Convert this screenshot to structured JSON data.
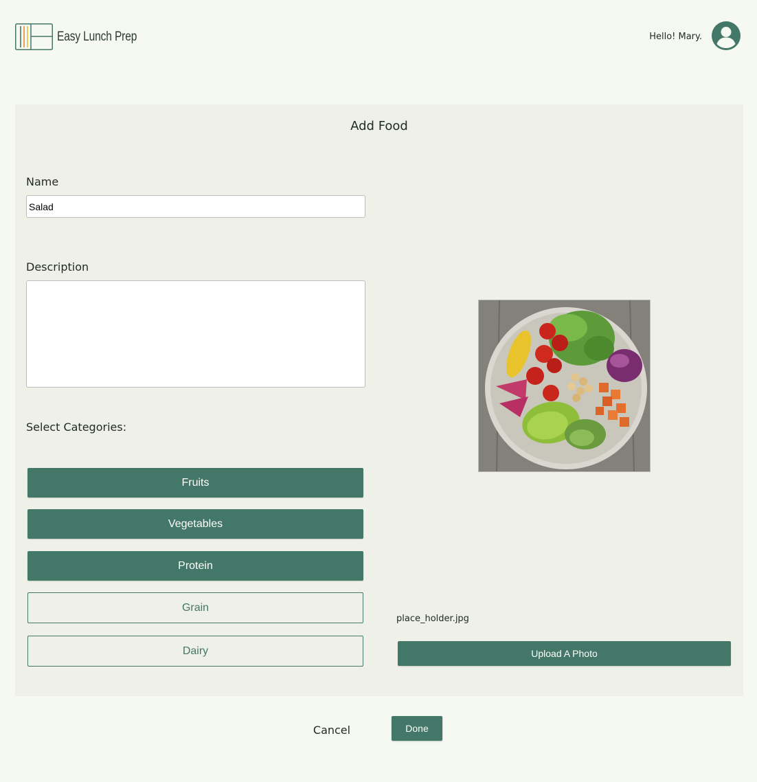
{
  "header": {
    "app_name": "Easy Lunch Prep",
    "greeting": "Hello! Mary."
  },
  "form": {
    "title": "Add Food",
    "name_label": "Name",
    "name_value": "Salad",
    "description_label": "Description",
    "description_value": "",
    "categories_label": "Select Categories:",
    "categories": [
      {
        "label": "Fruits",
        "selected": true
      },
      {
        "label": "Vegetables",
        "selected": true
      },
      {
        "label": "Protein",
        "selected": true
      },
      {
        "label": "Grain",
        "selected": false
      },
      {
        "label": "Dairy",
        "selected": false
      }
    ],
    "photo_filename": "place_holder.jpg",
    "upload_label": "Upload A Photo"
  },
  "actions": {
    "cancel_label": "Cancel",
    "done_label": "Done"
  },
  "colors": {
    "accent": "#437767",
    "page_background": "#f6f8f2",
    "panel_background": "#eff1e8"
  }
}
